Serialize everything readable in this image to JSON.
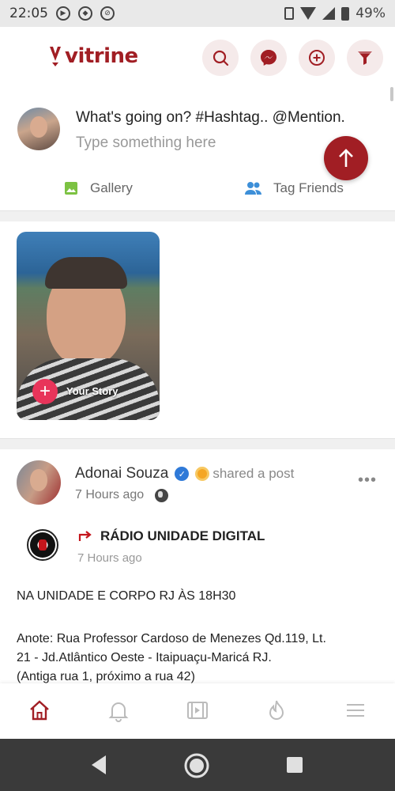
{
  "status_bar": {
    "time": "22:05",
    "battery": "49%"
  },
  "header": {
    "brand": "vitrine",
    "brand_color": "#a11e24",
    "actions": [
      "search-icon",
      "messenger-icon",
      "add-circle-icon",
      "filter-icon"
    ]
  },
  "composer": {
    "prompt": "What's going on? #Hashtag.. @Mention.",
    "placeholder": "Type something here",
    "gallery_label": "Gallery",
    "tag_friends_label": "Tag Friends"
  },
  "stories": {
    "your_story_label": "Your Story"
  },
  "post": {
    "author": "Adonai Souza",
    "action_text": "shared a post",
    "time": "7 Hours ago",
    "shared": {
      "page_name": "RÁDIO UNIDADE DIGITAL",
      "time": "7 Hours ago"
    },
    "lines": [
      "NA UNIDADE E CORPO RJ ÀS 18H30",
      "Anote: Rua Professor Cardoso de Menezes  Qd.119, Lt.",
      "21 - Jd.Atlântico Oeste - Itaipuaçu-Maricá RJ.",
      "(Antiga rua 1, próximo a rua 42)"
    ]
  },
  "bottom_nav": [
    "home-icon",
    "notifications-icon",
    "videos-icon",
    "trending-icon",
    "menu-icon"
  ],
  "colors": {
    "accent": "#a11e24",
    "story_add": "#e8345a",
    "verified": "#2f7ad8",
    "gallery_green": "#7cc242",
    "friends_blue": "#3d8fd8"
  }
}
